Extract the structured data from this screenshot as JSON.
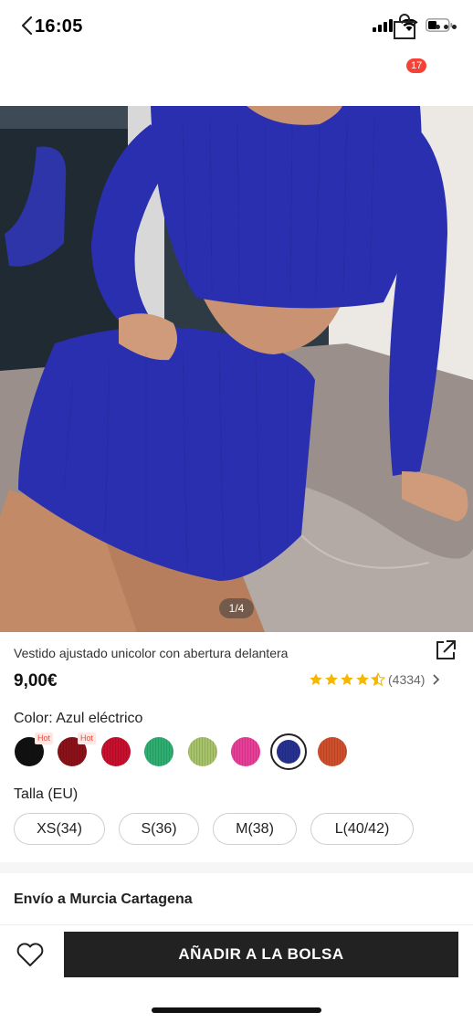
{
  "status_bar": {
    "time": "16:05",
    "icons": [
      "signal-icon",
      "wifi-icon",
      "battery-icon"
    ]
  },
  "nav": {
    "back_icon": "chevron-left-icon",
    "bag_icon": "shopping-bag-icon",
    "bag_count": "17",
    "more_icon": "more-dots-icon"
  },
  "gallery": {
    "counter": "1/4",
    "current_index": 1,
    "total": 4
  },
  "product": {
    "title": "Vestido ajustado unicolor con abertura delantera",
    "price": "9,00€",
    "rating_value": 4.5,
    "rating_count": "(4334)",
    "share_icon": "share-icon"
  },
  "color": {
    "label": "Color: Azul eléctrico",
    "swatches": [
      {
        "name": "black",
        "hex": "#111111",
        "hot": "Hot"
      },
      {
        "name": "burgundy",
        "hex": "#8b1219",
        "hot": "Hot"
      },
      {
        "name": "red",
        "hex": "#c8102e"
      },
      {
        "name": "green",
        "hex": "#2fae72"
      },
      {
        "name": "sage",
        "hex": "#a7c36a"
      },
      {
        "name": "pink",
        "hex": "#e83e98"
      },
      {
        "name": "electric-blue",
        "hex": "#27318f",
        "selected": true
      },
      {
        "name": "rust",
        "hex": "#cf4e2b"
      }
    ]
  },
  "size": {
    "label": "Talla (EU)",
    "options": [
      "XS(34)",
      "S(36)",
      "M(38)",
      "L(40/42)"
    ]
  },
  "shipping": {
    "label": "Envío a Murcia Cartagena"
  },
  "actions": {
    "wishlist_icon": "heart-icon",
    "add_to_bag": "AÑADIR A LA BOLSA"
  },
  "colors": {
    "accent": "#222222",
    "badge": "#f44336",
    "star": "#f5b800",
    "dress": "#2a2fb0"
  }
}
